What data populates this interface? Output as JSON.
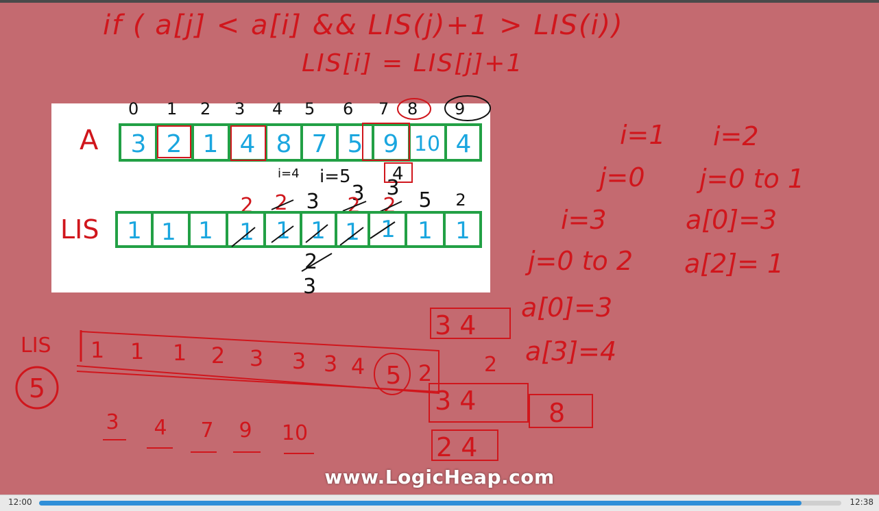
{
  "player": {
    "current_time": "12:00",
    "total_time": "12:38",
    "progress": 0.95
  },
  "watermark": "www.LogicHeap.com",
  "colors": {
    "background": "#c46a70",
    "ink_red": "#d0161c",
    "ink_blue": "#1aa6df",
    "ink_green": "#22a045",
    "ink_black": "#111111",
    "accent": "#2f8fd8"
  },
  "formula": {
    "line1": "if ( a[j] < a[i] && LIS(j)+1 > LIS(i))",
    "line2": "LIS[i] = LIS[j]+1"
  },
  "diagram": {
    "indices": [
      "0",
      "1",
      "2",
      "3",
      "4",
      "5",
      "6",
      "7",
      "8",
      "9"
    ],
    "array_label": "A",
    "array_values": [
      "3",
      "2",
      "1",
      "4",
      "8",
      "7",
      "5",
      "9",
      "10",
      "4"
    ],
    "lis_label": "LIS",
    "lis_values": [
      "1",
      "1",
      "1",
      "1",
      "1",
      "1",
      "1",
      "1",
      "1",
      "1"
    ],
    "above_lis": [
      "2",
      "2",
      "3",
      "3",
      "2",
      "3",
      "2",
      "5",
      "2"
    ],
    "under_array": [
      "i=4",
      "i=5",
      "4"
    ],
    "below_lis": [
      "2",
      "3"
    ]
  },
  "notes_right": {
    "i1": "i=1",
    "i2": "i=2",
    "j0": "j=0",
    "j0to1": "j=0 to 1",
    "i3": "i=3",
    "a0": "a[0]=3",
    "j0to2": "j=0 to 2",
    "a2": "a[2]= 1",
    "a0b": "a[0]=3",
    "a3": "a[3]=4",
    "box1": "3 4",
    "two": "2",
    "box2": "3 4",
    "box2b": "8",
    "box3": "2 4"
  },
  "lis_row": {
    "label": "LIS",
    "values": [
      "1",
      "1",
      "1",
      "2",
      "3",
      "3",
      "3",
      "4",
      "5",
      "2"
    ],
    "result": "5"
  },
  "sequence": [
    "3",
    "4",
    "7",
    "9",
    "10"
  ]
}
